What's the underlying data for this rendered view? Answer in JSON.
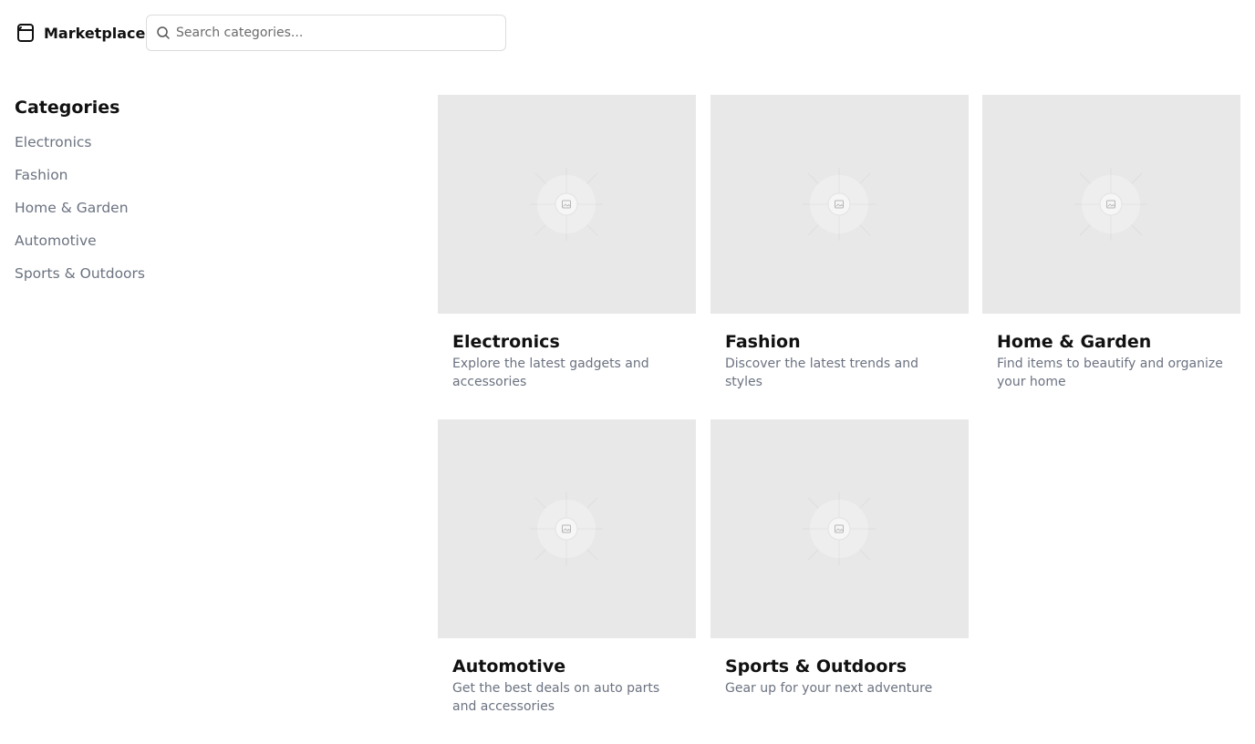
{
  "header": {
    "brand_icon": "shopping-bag-icon",
    "brand_title": "Marketplace",
    "search": {
      "icon": "search-icon",
      "placeholder": "Search categories...",
      "value": ""
    }
  },
  "sidebar": {
    "title": "Categories",
    "items": [
      {
        "label": "Electronics"
      },
      {
        "label": "Fashion"
      },
      {
        "label": "Home & Garden"
      },
      {
        "label": "Automotive"
      },
      {
        "label": "Sports & Outdoors"
      }
    ]
  },
  "cards": [
    {
      "title": "Electronics",
      "description": "Explore the latest gadgets and accessories",
      "image_icon": "image-placeholder-icon"
    },
    {
      "title": "Fashion",
      "description": "Discover the latest trends and styles",
      "image_icon": "image-placeholder-icon"
    },
    {
      "title": "Home & Garden",
      "description": "Find items to beautify and organize your home",
      "image_icon": "image-placeholder-icon"
    },
    {
      "title": "Automotive",
      "description": "Get the best deals on auto parts and accessories",
      "image_icon": "image-placeholder-icon"
    },
    {
      "title": "Sports & Outdoors",
      "description": "Gear up for your next adventure",
      "image_icon": "image-placeholder-icon"
    }
  ],
  "colors": {
    "text_primary": "#111111",
    "text_muted": "#6b7280",
    "image_bg": "#e8e8e8",
    "border": "#dcdcdc"
  }
}
